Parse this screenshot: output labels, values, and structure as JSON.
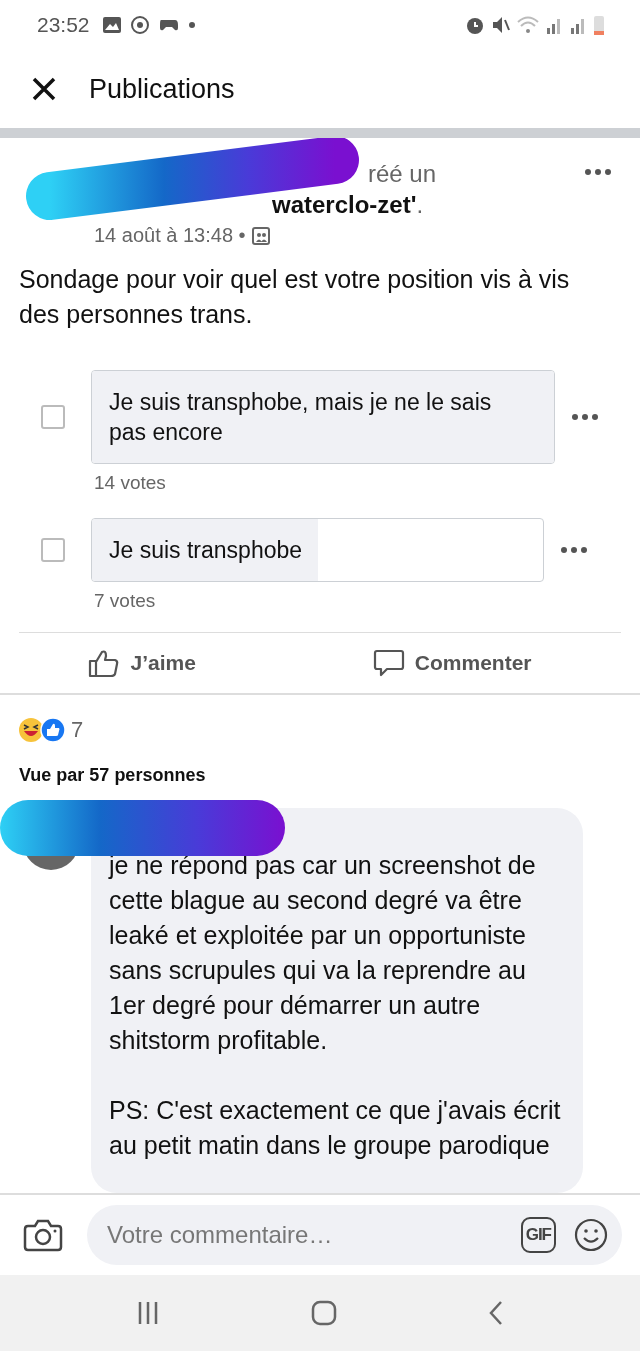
{
  "status_bar": {
    "time": "23:52"
  },
  "header": {
    "title": "Publications"
  },
  "post": {
    "author_line_fragments": [
      "réé un",
      "**waterclo-zet'**."
    ],
    "timestamp": "14 août à 13:48 •",
    "text": "Sondage pour voir quel est votre position vis à vis des personnes trans.",
    "poll": {
      "options": [
        {
          "label": "Je suis transphobe, mais je ne le sais pas encore",
          "level": 1.0,
          "checked": false,
          "votes": "14 votes"
        },
        {
          "label": "Je suis transphobe",
          "level": 0.5,
          "checked": false,
          "votes": "7 votes"
        }
      ]
    },
    "actions": [
      "J’aime",
      "Commenter"
    ],
    "reactions": {
      "count": "7"
    },
    "seen_by": "Vue par 57 personnes"
  },
  "comments": [
    {
      "paragraphs": [
        "je ne répond pas car un screenshot de cette blague au second degré va être leaké et exploitée par un opportuniste sans scrupules qui va la reprendre au 1er degré pour démarrer un autre shitstorm profitable.",
        "PS: C'est exactement ce que j'avais écrit au petit matin dans le groupe parodique"
      ]
    }
  ],
  "composer": {
    "placeholder": "Votre commentaire…",
    "gif": "GIF"
  }
}
